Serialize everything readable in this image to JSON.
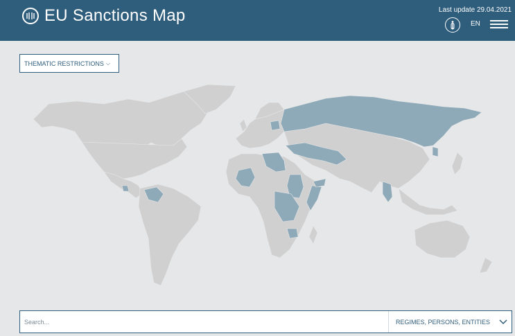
{
  "header": {
    "title": "EU Sanctions Map",
    "last_update": "Last update 29.04.2021",
    "language": "EN",
    "icons": {
      "logo": "eu-logo-icon",
      "info": "info-icon",
      "menu": "hamburger-menu-icon"
    }
  },
  "filters": {
    "thematic_label": "THEMATIC RESTRICTIONS"
  },
  "search": {
    "placeholder": "Search...",
    "type_label": "REGIMES, PERSONS, ENTITIES"
  },
  "colors": {
    "brand": "#2f5d7c",
    "background": "#e6e7e8",
    "land": "#d0d0d0",
    "sanctioned": "#8ea9b8"
  }
}
